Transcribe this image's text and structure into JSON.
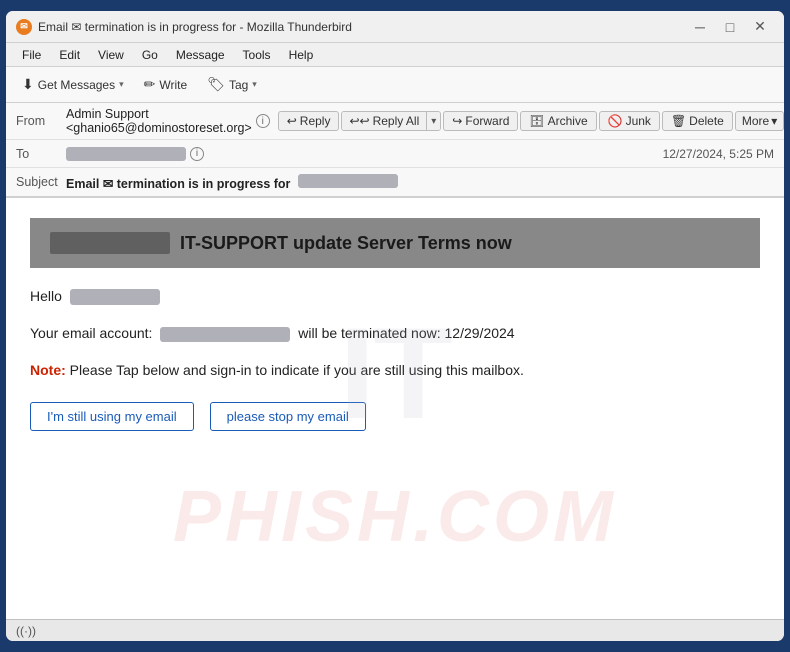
{
  "titlebar": {
    "icon": "✉",
    "title": "Email ✉ termination is in progress for             - Mozilla Thunderbird",
    "minimize": "─",
    "maximize": "□",
    "close": "✕"
  },
  "menubar": {
    "items": [
      "File",
      "Edit",
      "View",
      "Go",
      "Message",
      "Tools",
      "Help"
    ]
  },
  "toolbar": {
    "get_messages": "Get Messages",
    "write": "Write",
    "tag": "Tag"
  },
  "actions": {
    "reply": "Reply",
    "reply_all": "Reply All",
    "forward": "Forward",
    "archive": "Archive",
    "junk": "Junk",
    "delete": "Delete",
    "more": "More"
  },
  "headers": {
    "from_label": "From",
    "from_value": "Admin Support <ghanio65@dominostoreset.org>",
    "to_label": "To",
    "subject_label": "Subject",
    "subject_value": "Email ✉ termination is in progress for",
    "timestamp": "12/27/2024, 5:25 PM"
  },
  "email": {
    "banner_title": "IT-SUPPORT update Server Terms now",
    "hello": "Hello",
    "body_line1_pre": "Your email account:",
    "body_line1_post": "will be terminated now: 12/29/2024",
    "note_label": "Note:",
    "note_text": "Please Tap below and sign-in to indicate if you are still using this mailbox.",
    "btn1": "I'm still using my email",
    "btn2": "please stop my email",
    "watermark": "PHISH.COM"
  },
  "statusbar": {
    "icon": "((·))"
  }
}
